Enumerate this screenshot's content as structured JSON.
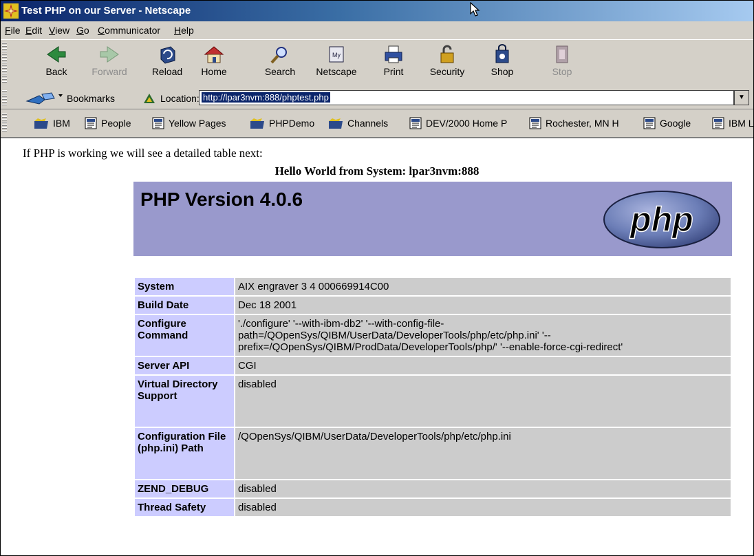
{
  "window": {
    "title": "Test PHP on our Server - Netscape"
  },
  "menu": [
    "File",
    "Edit",
    "View",
    "Go",
    "Communicator",
    "Help"
  ],
  "toolbar": [
    {
      "label": "Back",
      "icon": "back-arrow-icon",
      "enabled": true
    },
    {
      "label": "Forward",
      "icon": "forward-arrow-icon",
      "enabled": false
    },
    {
      "label": "Reload",
      "icon": "reload-icon",
      "enabled": true
    },
    {
      "label": "Home",
      "icon": "home-icon",
      "enabled": true
    },
    {
      "label": "Search",
      "icon": "search-icon",
      "enabled": true
    },
    {
      "label": "Netscape",
      "icon": "my-netscape-icon",
      "enabled": true
    },
    {
      "label": "Print",
      "icon": "printer-icon",
      "enabled": true
    },
    {
      "label": "Security",
      "icon": "padlock-icon",
      "enabled": true
    },
    {
      "label": "Shop",
      "icon": "shopping-bag-icon",
      "enabled": true
    },
    {
      "label": "Stop",
      "icon": "stop-icon",
      "enabled": false
    }
  ],
  "location": {
    "bookmarks_label": "Bookmarks",
    "location_label": "Location:",
    "url": "http://lpar3nvm:888/phptest.php"
  },
  "personal_toolbar": [
    {
      "label": "IBM",
      "icon": "folder-icon"
    },
    {
      "label": "People",
      "icon": "bookmark-page-icon"
    },
    {
      "label": "Yellow Pages",
      "icon": "bookmark-page-icon"
    },
    {
      "label": "PHPDemo",
      "icon": "folder-icon"
    },
    {
      "label": "Channels",
      "icon": "folder-icon"
    },
    {
      "label": "DEV/2000 Home P",
      "icon": "bookmark-page-icon"
    },
    {
      "label": "Rochester, MN H",
      "icon": "bookmark-page-icon"
    },
    {
      "label": "Google",
      "icon": "bookmark-page-icon"
    },
    {
      "label": "IBM L",
      "icon": "bookmark-page-icon"
    }
  ],
  "page": {
    "intro": "If PHP is working we will see a detailed table next:",
    "hello": "Hello World from System: lpar3nvm:888",
    "php_version": "PHP Version 4.0.6",
    "logo_text": "php",
    "colors": {
      "header_bg": "#9999cc",
      "key_bg": "#ccccff",
      "value_bg": "#cccccc",
      "logo_bg": "#6c7eb7"
    },
    "info_rows": [
      {
        "key": "System",
        "value": "AIX engraver 3 4 000669914C00"
      },
      {
        "key": "Build Date",
        "value": "Dec 18 2001"
      },
      {
        "key": "Configure Command",
        "value": " './configure' '--with-ibm-db2' '--with-config-file-path=/QOpenSys/QIBM/UserData/DeveloperTools/php/etc/php.ini' '--prefix=/QOpenSys/QIBM/ProdData/DeveloperTools/php/' '--enable-force-cgi-redirect'"
      },
      {
        "key": "Server API",
        "value": "CGI"
      },
      {
        "key": "Virtual Directory Support",
        "value": "disabled"
      },
      {
        "key": "Configuration File (php.ini) Path",
        "value": "/QOpenSys/QIBM/UserData/DeveloperTools/php/etc/php.ini"
      },
      {
        "key": "ZEND_DEBUG",
        "value": "disabled"
      },
      {
        "key": "Thread Safety",
        "value": "disabled"
      }
    ]
  }
}
